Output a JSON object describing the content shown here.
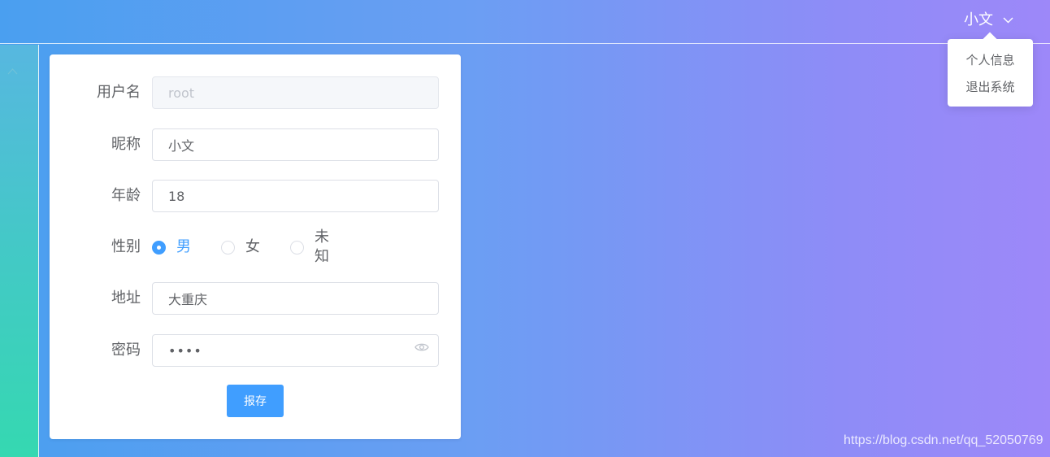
{
  "header": {
    "user_name": "小文"
  },
  "user_menu": {
    "items": [
      "个人信息",
      "退出系统"
    ]
  },
  "form": {
    "username": {
      "label": "用户名",
      "value": "root"
    },
    "nickname": {
      "label": "昵称",
      "value": "小文"
    },
    "age": {
      "label": "年龄",
      "value": "18"
    },
    "gender": {
      "label": "性别",
      "options": [
        "男",
        "女",
        "未知"
      ],
      "selected": "男"
    },
    "address": {
      "label": "地址",
      "value": "大重庆"
    },
    "password": {
      "label": "密码",
      "value": "••••"
    },
    "save_label": "报存"
  },
  "watermark": "https://blog.csdn.net/qq_52050769",
  "colors": {
    "primary": "#409eff",
    "sidebar_top": "#57b7e0",
    "sidebar_bottom": "#35d8b1",
    "header_left": "#4a9ff0",
    "header_right": "#9d88f9"
  },
  "icons": [
    "chevron-down-icon",
    "chevron-up-icon",
    "eye-icon"
  ]
}
